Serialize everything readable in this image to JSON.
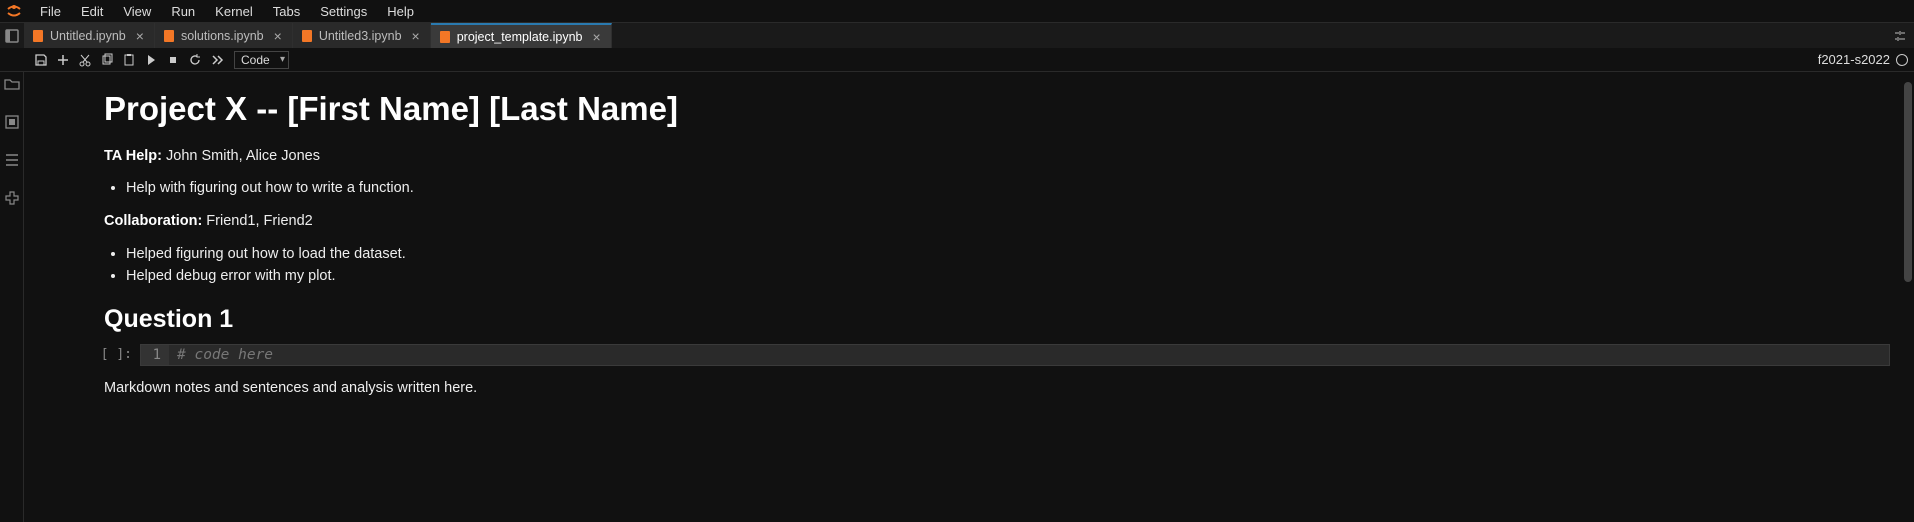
{
  "menubar": {
    "items": [
      "File",
      "Edit",
      "View",
      "Run",
      "Kernel",
      "Tabs",
      "Settings",
      "Help"
    ]
  },
  "tabs": [
    {
      "label": "Untitled.ipynb",
      "active": false
    },
    {
      "label": "solutions.ipynb",
      "active": false
    },
    {
      "label": "Untitled3.ipynb",
      "active": false
    },
    {
      "label": "project_template.ipynb",
      "active": true
    }
  ],
  "toolbar": {
    "cell_type": "Code",
    "kernel_name": "f2021-s2022"
  },
  "notebook": {
    "title": "Project X -- [First Name] [Last Name]",
    "ta_label": "TA Help:",
    "ta_names": " John Smith, Alice Jones",
    "ta_bullets": [
      "Help with figuring out how to write a function."
    ],
    "collab_label": "Collaboration:",
    "collab_names": " Friend1, Friend2",
    "collab_bullets": [
      "Helped figuring out how to load the dataset.",
      "Helped debug error with my plot."
    ],
    "q1_heading": "Question 1",
    "code_prompt": "[ ]:",
    "code_line_no": "1",
    "code_text": "# code here",
    "md_notes": "Markdown notes and sentences and analysis written here."
  }
}
